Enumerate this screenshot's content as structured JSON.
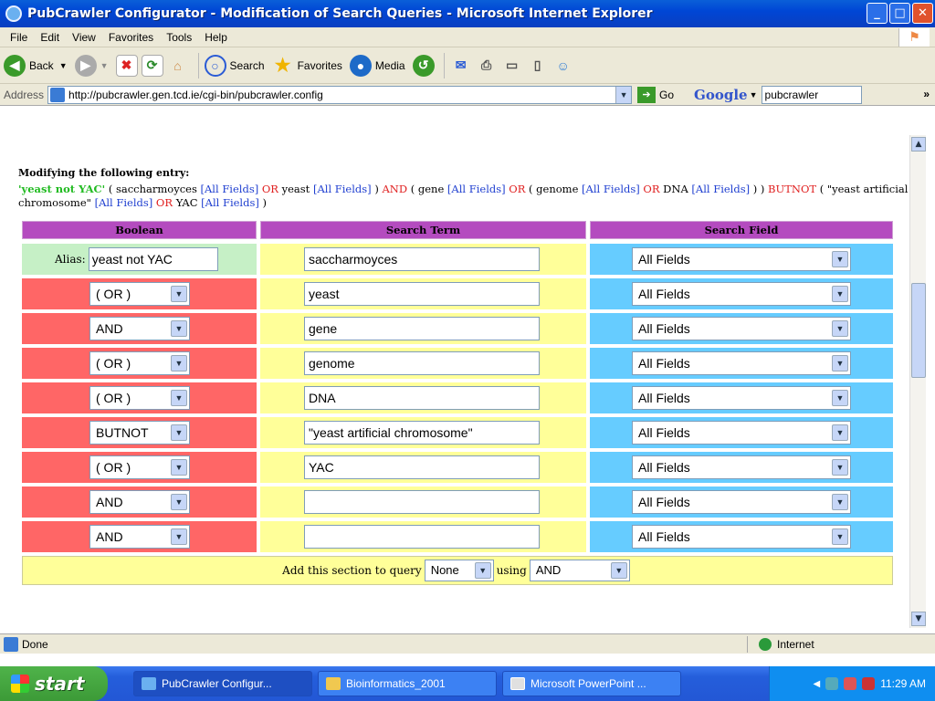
{
  "window": {
    "title": "PubCrawler Configurator - Modification of Search Queries - Microsoft Internet Explorer"
  },
  "menu": [
    "File",
    "Edit",
    "View",
    "Favorites",
    "Tools",
    "Help"
  ],
  "toolbar": {
    "back": "Back",
    "search": "Search",
    "favorites": "Favorites",
    "media": "Media"
  },
  "address": {
    "label": "Address",
    "url": "http://pubcrawler.gen.tcd.ie/cgi-bin/pubcrawler.config",
    "go": "Go",
    "google": "Google",
    "google_query": "pubcrawler",
    "more": "»"
  },
  "page": {
    "heading": "Modifying the following entry:",
    "query": [
      {
        "t": "'yeast not YAC'",
        "k": "alias"
      },
      {
        "t": " ( saccharmoyces ",
        "k": "term"
      },
      {
        "t": "[All Fields]",
        "k": "field"
      },
      {
        "t": " OR ",
        "k": "op"
      },
      {
        "t": "yeast ",
        "k": "term"
      },
      {
        "t": "[All Fields]",
        "k": "field"
      },
      {
        "t": " ) ",
        "k": "term"
      },
      {
        "t": "AND",
        "k": "op"
      },
      {
        "t": " ( gene ",
        "k": "term"
      },
      {
        "t": "[All Fields]",
        "k": "field"
      },
      {
        "t": " OR ",
        "k": "op"
      },
      {
        "t": "( genome ",
        "k": "term"
      },
      {
        "t": "[All Fields]",
        "k": "field"
      },
      {
        "t": " OR ",
        "k": "op"
      },
      {
        "t": "DNA ",
        "k": "term"
      },
      {
        "t": "[All Fields]",
        "k": "field"
      },
      {
        "t": " ) )",
        "k": "term"
      },
      {
        "t": " BUTNOT",
        "k": "op"
      },
      {
        "t": " ( \"yeast artificial chromosome\" ",
        "k": "term"
      },
      {
        "t": "[All Fields]",
        "k": "field"
      },
      {
        "t": " OR ",
        "k": "op"
      },
      {
        "t": "YAC ",
        "k": "term"
      },
      {
        "t": "[All Fields]",
        "k": "field"
      },
      {
        "t": " )",
        "k": "term"
      }
    ],
    "columns": {
      "boolean": "Boolean",
      "term": "Search Term",
      "field": "Search Field"
    },
    "alias_label": "Alias:",
    "alias_value": "yeast not YAC",
    "rows": [
      {
        "boolean": null,
        "term": "saccharmoyces",
        "field": "All Fields"
      },
      {
        "boolean": "( OR )",
        "term": "yeast",
        "field": "All Fields"
      },
      {
        "boolean": "AND",
        "term": "gene",
        "field": "All Fields"
      },
      {
        "boolean": "( OR )",
        "term": "genome",
        "field": "All Fields"
      },
      {
        "boolean": "( OR )",
        "term": "DNA",
        "field": "All Fields"
      },
      {
        "boolean": "BUTNOT",
        "term": "\"yeast artificial chromosome\"",
        "field": "All Fields"
      },
      {
        "boolean": "( OR )",
        "term": "YAC",
        "field": "All Fields"
      },
      {
        "boolean": "AND",
        "term": "",
        "field": "All Fields"
      },
      {
        "boolean": "AND",
        "term": "",
        "field": "All Fields"
      }
    ],
    "footer": {
      "prefix": "Add this section to query",
      "section_value": "None",
      "using": "using",
      "op_value": "AND"
    }
  },
  "status": {
    "text": "Done",
    "zone": "Internet"
  },
  "taskbar": {
    "start": "start",
    "tasks": [
      "PubCrawler Configur...",
      "Bioinformatics_2001",
      "Microsoft PowerPoint ..."
    ],
    "clock": "11:29 AM"
  }
}
